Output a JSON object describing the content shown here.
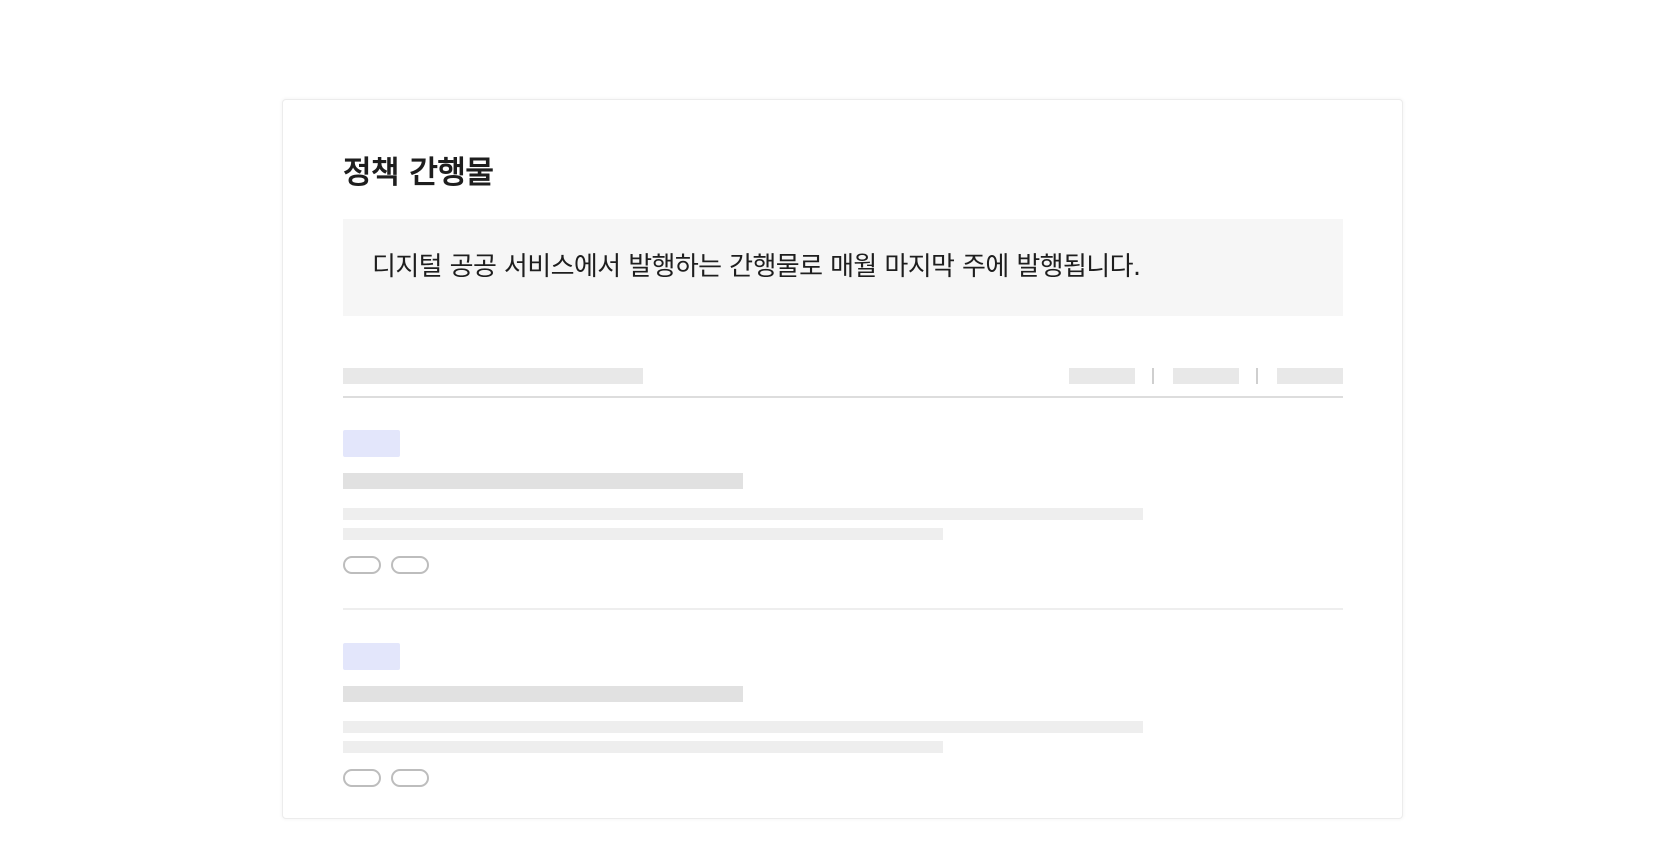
{
  "page": {
    "title": "정책 간행물",
    "description": "디지털 공공 서비스에서 발행하는 간행물로 매월 마지막 주에 발행됩니다."
  },
  "list": {
    "state": "loading-skeleton",
    "skeleton_items": 2
  },
  "colors": {
    "title_text": "#1e1e1e",
    "description_bg": "#f6f6f6",
    "skeleton": "#e8e8e8",
    "skeleton_light": "#eeeeee",
    "badge_skeleton": "#e3e6fb",
    "chip_border": "#bdbdbd"
  }
}
